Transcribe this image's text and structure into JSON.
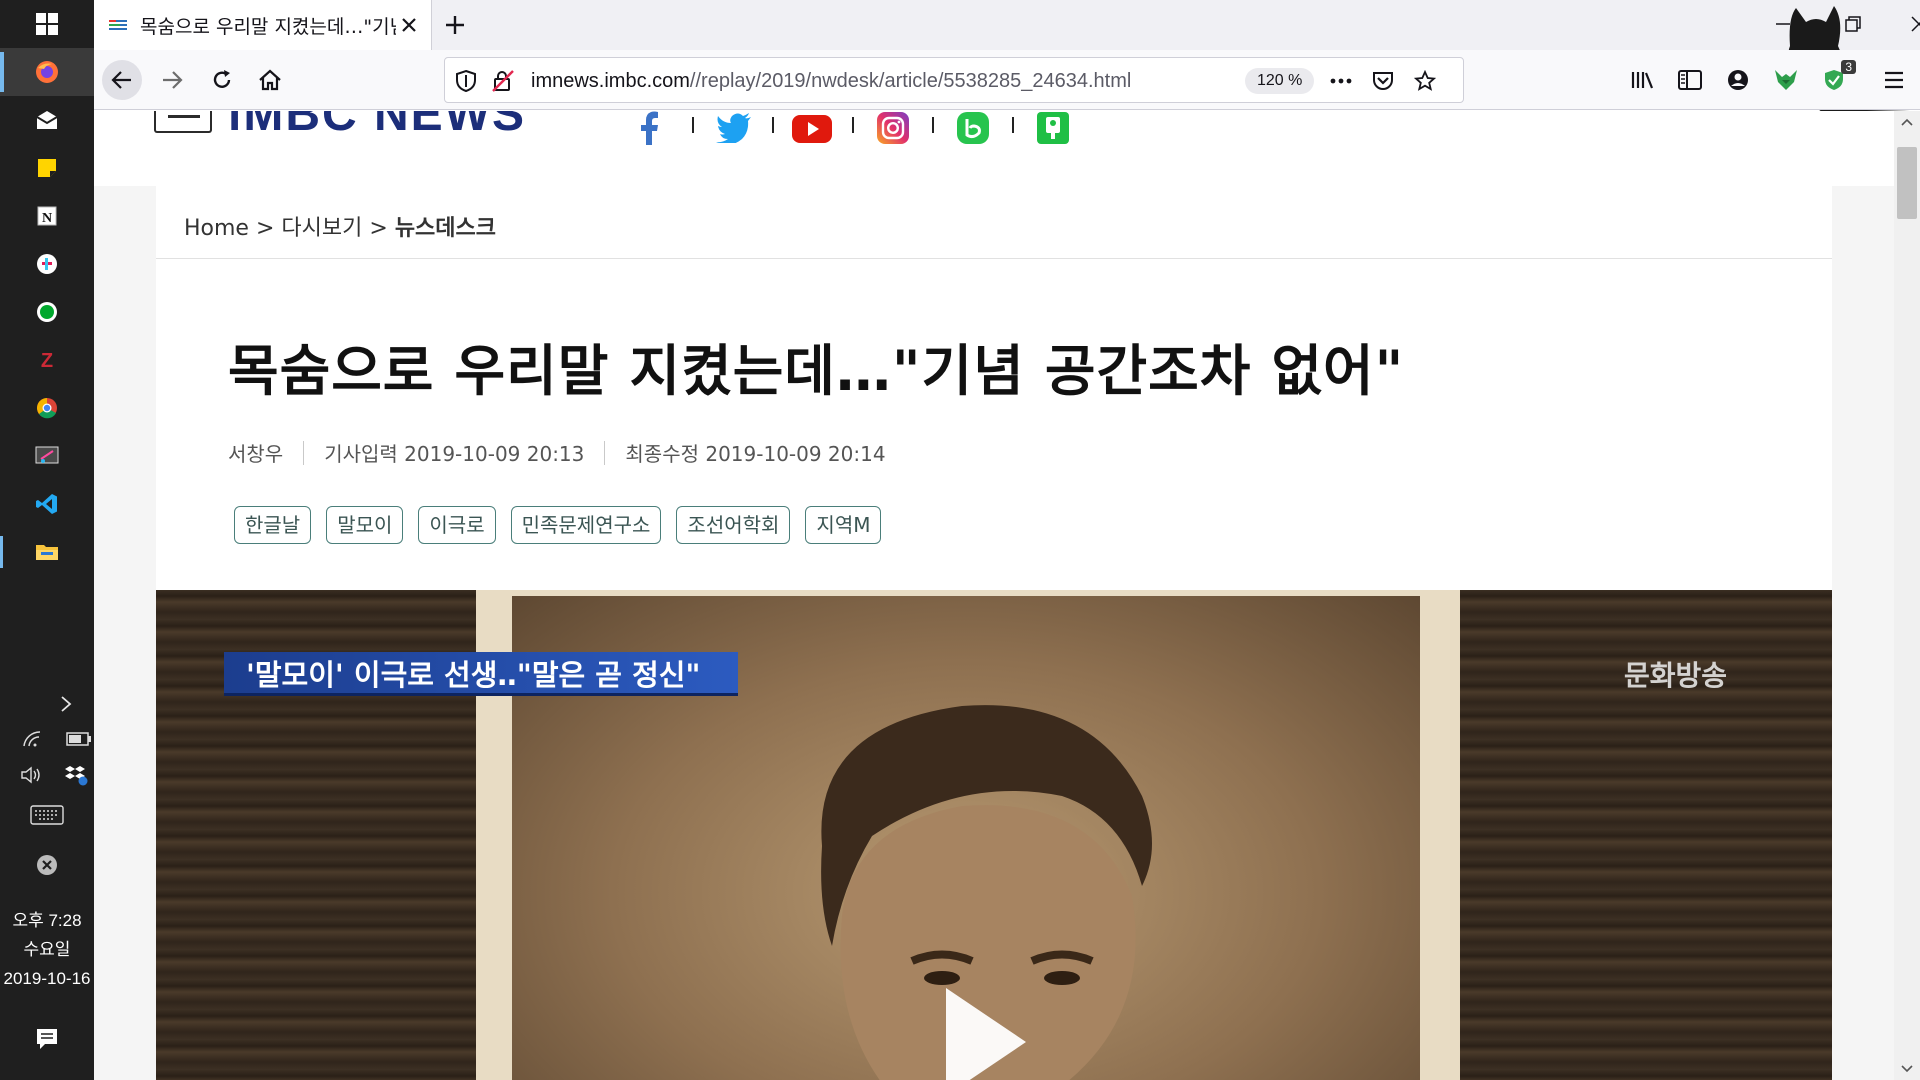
{
  "browser": {
    "tab_title": "목숨으로 우리말 지켰는데…\"기념 공간조차 없어\"",
    "url_host": "imnews.imbc.com",
    "url_path": "//replay/2019/nwdesk/article/5538285_24634.html",
    "zoom": "120 %",
    "extension_badge": "3"
  },
  "taskbar": {
    "time": "오후 7:28",
    "weekday": "수요일",
    "date": "2019-10-16"
  },
  "site": {
    "logo": "iMBC NEWS",
    "social": [
      "facebook-icon",
      "twitter-icon",
      "youtube-icon",
      "instagram-icon",
      "band-icon",
      "kakaostory-icon"
    ]
  },
  "breadcrumb": {
    "home": "Home",
    "sep": ">",
    "level1": "다시보기",
    "level2": "뉴스데스크"
  },
  "article": {
    "title": "목숨으로 우리말 지켰는데…\"기념 공간조차 없어\"",
    "author": "서창우",
    "published_label": "기사입력 2019-10-09 20:13",
    "modified_label": "최종수정 2019-10-09 20:14",
    "tags": [
      "한글날",
      "말모이",
      "이극로",
      "민족문제연구소",
      "조선어학회",
      "지역M"
    ]
  },
  "video": {
    "caption": "'말모이' 이극로 선생‥\"말은 곧 정신\"",
    "broadcaster": "문화방송"
  },
  "colors": {
    "taskbar": "#1f1f1f",
    "accent": "#76b9ed",
    "tag_border": "#4a7e7a",
    "caption_bar": "#2c5bc0"
  }
}
